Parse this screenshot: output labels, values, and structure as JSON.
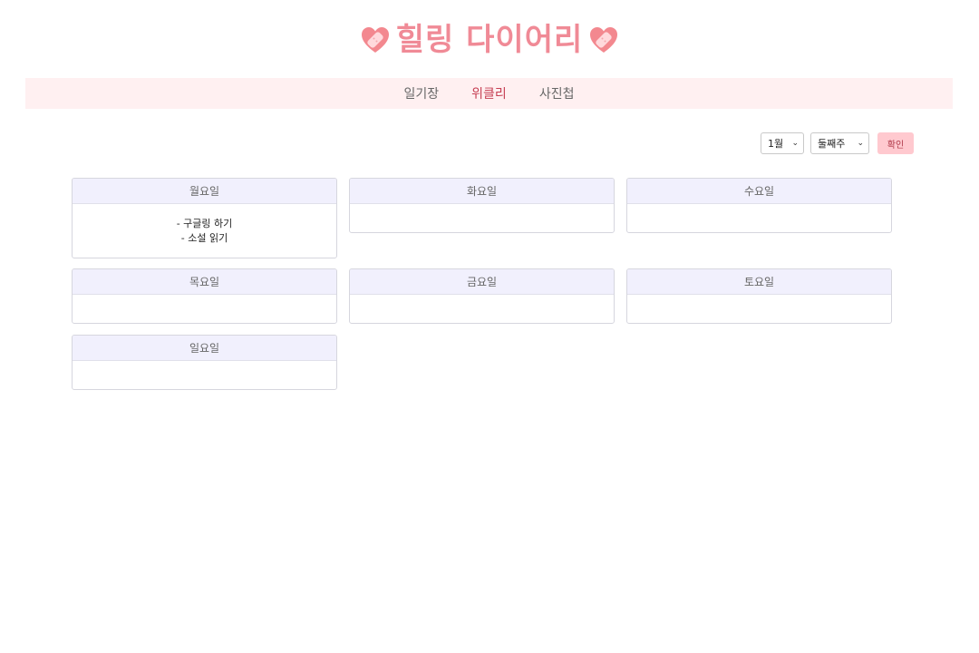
{
  "header": {
    "title": "힐링 다이어리",
    "left_icon": "heart-bandage-icon",
    "right_icon": "heart-bandage-icon"
  },
  "nav": {
    "items": [
      {
        "label": "일기장",
        "active": false
      },
      {
        "label": "위클리",
        "active": true
      },
      {
        "label": "사진첩",
        "active": false
      }
    ]
  },
  "controls": {
    "month_value": "1월",
    "week_value": "둘째주",
    "confirm_label": "확인"
  },
  "days": [
    {
      "label": "월요일",
      "entries": [
        "- 구글링 하기",
        "- 소설 읽기"
      ]
    },
    {
      "label": "화요일",
      "entries": []
    },
    {
      "label": "수요일",
      "entries": []
    },
    {
      "label": "목요일",
      "entries": []
    },
    {
      "label": "금요일",
      "entries": []
    },
    {
      "label": "토요일",
      "entries": []
    },
    {
      "label": "일요일",
      "entries": []
    }
  ],
  "colors": {
    "accent": "#f08a96",
    "nav_bg": "#fff0f1",
    "active_nav": "#c63e52",
    "card_head": "#f1f0fd",
    "button_bg": "#ffc9cf"
  }
}
